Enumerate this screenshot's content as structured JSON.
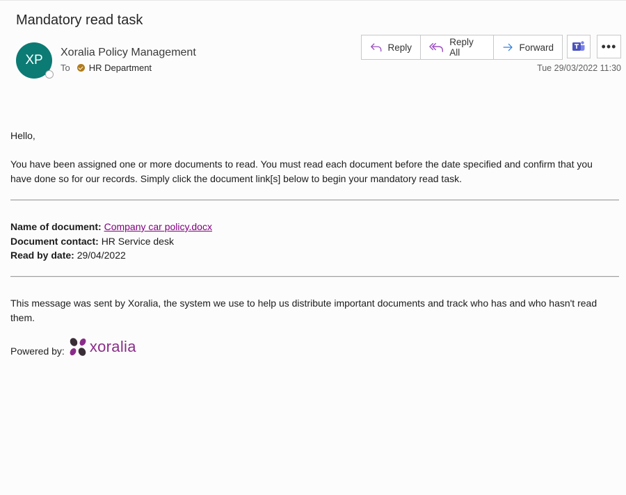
{
  "email": {
    "subject": "Mandatory read task",
    "avatar_initials": "XP",
    "sender": "Xoralia Policy Management",
    "to_label": "To",
    "recipient": "HR Department",
    "timestamp": "Tue 29/03/2022 11:30"
  },
  "actions": {
    "reply": "Reply",
    "reply_all": "Reply All",
    "forward": "Forward",
    "teams_icon": "teams-icon",
    "more": "•••"
  },
  "body": {
    "greeting": "Hello,",
    "intro": "You have been assigned one or more documents to read. You must read each document before the date specified and confirm that you have done so for our records. Simply click the document link[s] below to begin your mandatory read task.",
    "name_label": "Name of document:",
    "name_value": "Company car policy.docx",
    "contact_label": "Document contact:",
    "contact_value": "HR Service desk",
    "date_label": "Read by date:",
    "date_value": "29/04/2022",
    "footer": "This message was sent by Xoralia, the system we use to help us distribute important documents and track who has and who hasn't read them.",
    "powered_label": "Powered by:",
    "logo_text": "xoralia"
  },
  "colors": {
    "avatar": "#0b7b74",
    "link": "#800080",
    "logo_purple": "#8a2d8a",
    "logo_dark": "#3a2e36",
    "reply_icon": "#9b4fc2",
    "forward_icon": "#2f7ed8"
  }
}
